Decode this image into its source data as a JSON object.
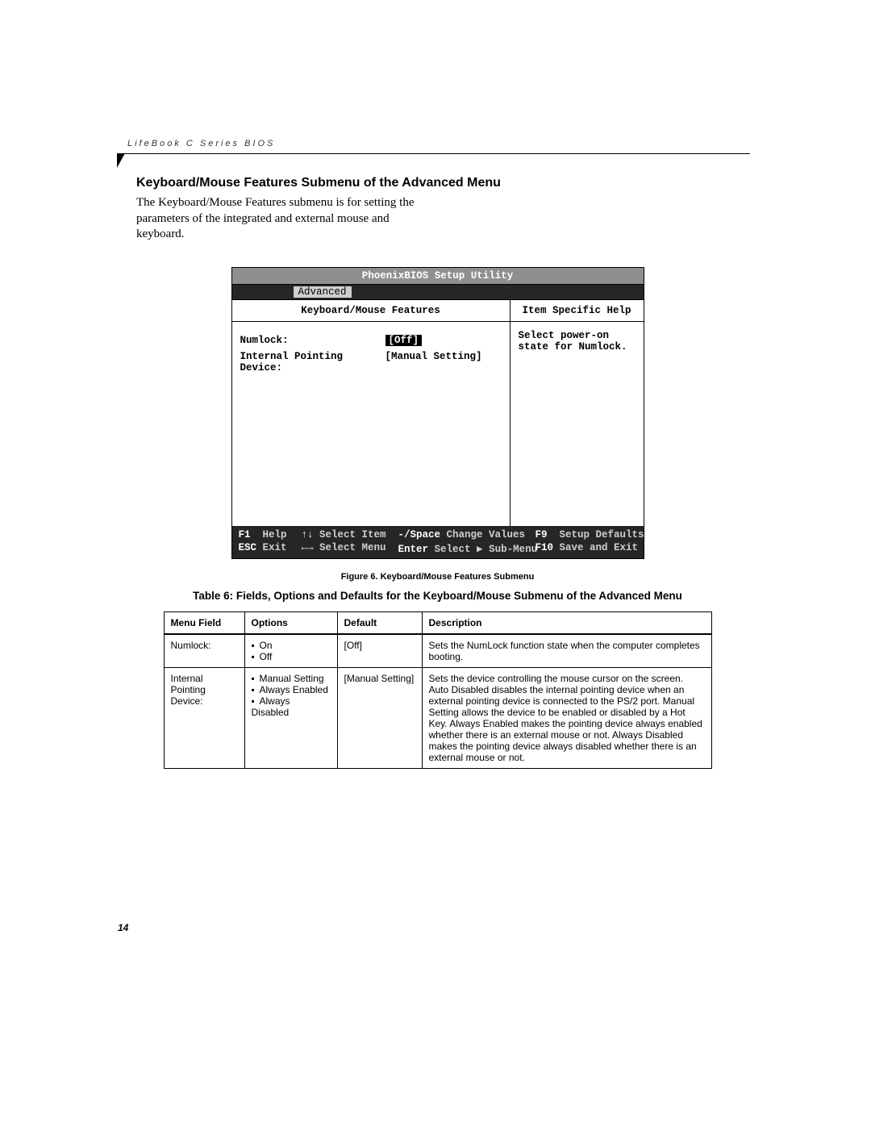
{
  "running_head": "LifeBook C Series BIOS",
  "section_title": "Keyboard/Mouse Features Submenu of the Advanced Menu",
  "intro": "The Keyboard/Mouse Features submenu is for setting the parameters of the integrated and external mouse and keyboard.",
  "bios": {
    "title": "PhoenixBIOS Setup Utility",
    "active_tab": "Advanced",
    "left_title": "Keyboard/Mouse Features",
    "right_title": "Item Specific Help",
    "fields": [
      {
        "label": "Numlock:",
        "value": "[Off]",
        "highlight": true
      },
      {
        "label": "Internal Pointing Device:",
        "value": "[Manual Setting]",
        "highlight": false
      }
    ],
    "help_text": "Select power-on state for Numlock.",
    "footer": {
      "r1": {
        "a": "F1",
        "al": "Help",
        "b": "↑↓",
        "bl": "Select Item",
        "c": "-/Space",
        "cl": "Change Values",
        "d": "F9",
        "dl": "Setup Defaults"
      },
      "r2": {
        "a": "ESC",
        "al": "Exit",
        "b": "←→",
        "bl": "Select Menu",
        "c": "Enter",
        "cl": "Select ▶ Sub-Menu",
        "d": "F10",
        "dl": "Save and Exit"
      }
    }
  },
  "figure_caption": "Figure 6.  Keyboard/Mouse Features Submenu",
  "table_title": "Table 6: Fields, Options and Defaults for the Keyboard/Mouse Submenu of the Advanced Menu",
  "table": {
    "headers": {
      "c1": "Menu Field",
      "c2": "Options",
      "c3": "Default",
      "c4": "Description"
    },
    "rows": [
      {
        "field": "Numlock:",
        "options": [
          "On",
          "Off"
        ],
        "default": "[Off]",
        "desc": "Sets the NumLock function state when the computer completes booting."
      },
      {
        "field": "Internal Pointing Device:",
        "options": [
          "Manual Setting",
          "Always Enabled",
          "Always Disabled"
        ],
        "default": "[Manual Setting]",
        "desc": "Sets the device controlling the mouse cursor on the screen. Auto Disabled disables the internal pointing device when an external pointing device is connected to the PS/2 port. Manual Setting allows the device to be enabled or disabled by a Hot Key. Always Enabled makes the pointing device always enabled whether there is an external mouse or not. Always Disabled makes the pointing device always disabled whether there is an external mouse or not."
      }
    ]
  },
  "page_number": "14"
}
